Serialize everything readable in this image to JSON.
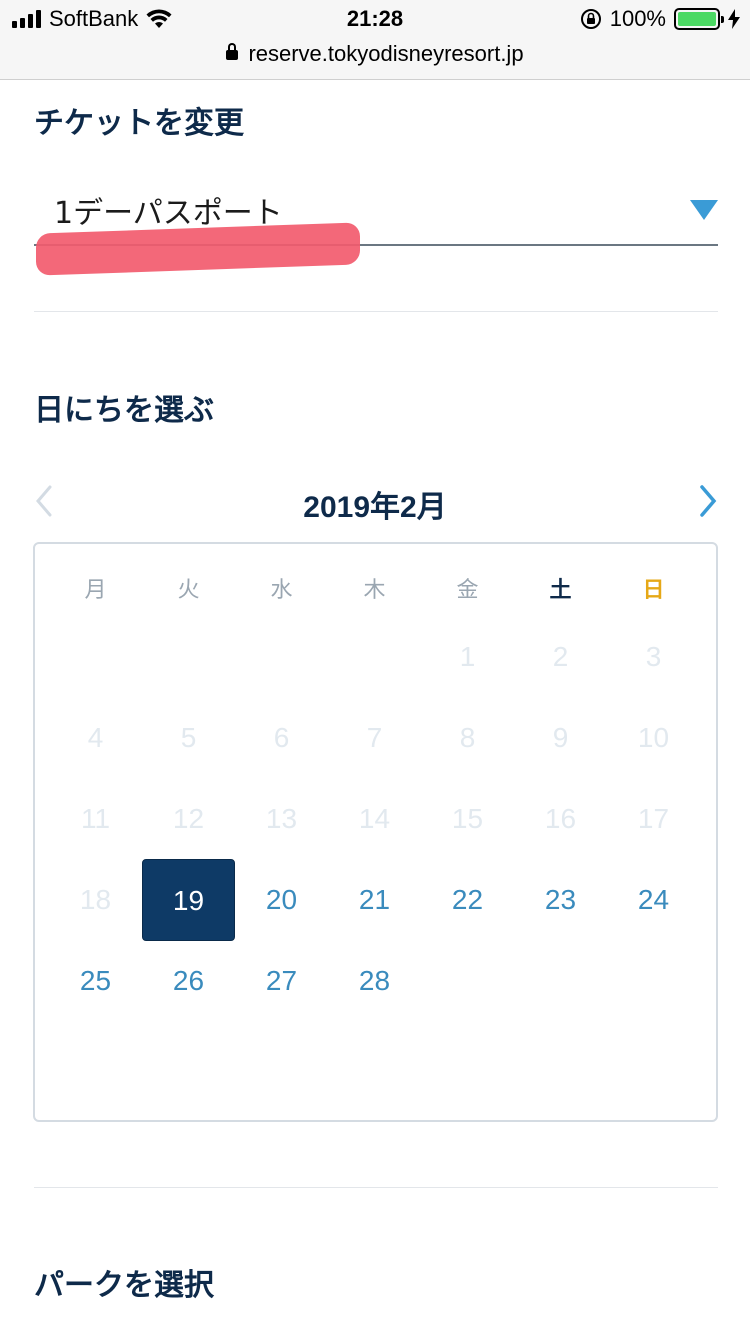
{
  "status_bar": {
    "carrier": "SoftBank",
    "time": "21:28",
    "battery": "100%"
  },
  "browser": {
    "url": "reserve.tokyodisneyresort.jp"
  },
  "ticket_section": {
    "heading": "チケットを変更",
    "selected_ticket": "1デーパスポート"
  },
  "date_section": {
    "heading": "日にちを選ぶ",
    "month_title": "2019年2月",
    "weekdays": [
      "月",
      "火",
      "水",
      "木",
      "金",
      "土",
      "日"
    ],
    "weekday_colors": {
      "weekday": "#9aa6b1",
      "saturday": "#0e2a4a",
      "sunday": "#e6a817"
    },
    "days": [
      {
        "label": "1",
        "state": "disabled"
      },
      {
        "label": "2",
        "state": "disabled"
      },
      {
        "label": "3",
        "state": "disabled"
      },
      {
        "label": "4",
        "state": "disabled"
      },
      {
        "label": "5",
        "state": "disabled"
      },
      {
        "label": "6",
        "state": "disabled"
      },
      {
        "label": "7",
        "state": "disabled"
      },
      {
        "label": "8",
        "state": "disabled"
      },
      {
        "label": "9",
        "state": "disabled"
      },
      {
        "label": "10",
        "state": "disabled"
      },
      {
        "label": "11",
        "state": "disabled"
      },
      {
        "label": "12",
        "state": "disabled"
      },
      {
        "label": "13",
        "state": "disabled"
      },
      {
        "label": "14",
        "state": "disabled"
      },
      {
        "label": "15",
        "state": "disabled"
      },
      {
        "label": "16",
        "state": "disabled"
      },
      {
        "label": "17",
        "state": "disabled"
      },
      {
        "label": "18",
        "state": "disabled"
      },
      {
        "label": "19",
        "state": "selected"
      },
      {
        "label": "20",
        "state": "available"
      },
      {
        "label": "21",
        "state": "available"
      },
      {
        "label": "22",
        "state": "available"
      },
      {
        "label": "23",
        "state": "available"
      },
      {
        "label": "24",
        "state": "available"
      },
      {
        "label": "25",
        "state": "available"
      },
      {
        "label": "26",
        "state": "available"
      },
      {
        "label": "27",
        "state": "available"
      },
      {
        "label": "28",
        "state": "available"
      }
    ]
  },
  "park_section": {
    "heading": "パークを選択"
  },
  "colors": {
    "navy": "#0e2a4a",
    "accent_blue": "#3a9bd6",
    "selected_bg": "#0e3a66",
    "redaction": "#f25b6e"
  }
}
